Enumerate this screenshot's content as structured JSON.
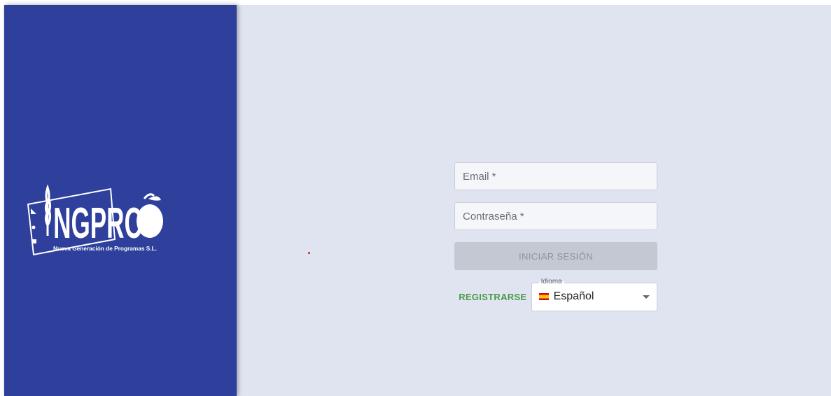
{
  "brand": {
    "logo_text": "NGPRO",
    "tagline": "Nueva Generación de Programas S.L.",
    "panel_color": "#2e3f9c"
  },
  "login": {
    "email_placeholder": "Email *",
    "password_placeholder": "Contraseña *",
    "submit_label": "INICIAR SESIÓN",
    "submit_enabled": false,
    "register_label": "REGISTRARSE"
  },
  "language": {
    "legend": "Idioma",
    "selected": "Español",
    "flag_icon": "spain-flag-icon"
  },
  "colors": {
    "background": "#dfe4f0",
    "register_link": "#4a9a4a",
    "disabled_button": "#c3c8d2"
  }
}
